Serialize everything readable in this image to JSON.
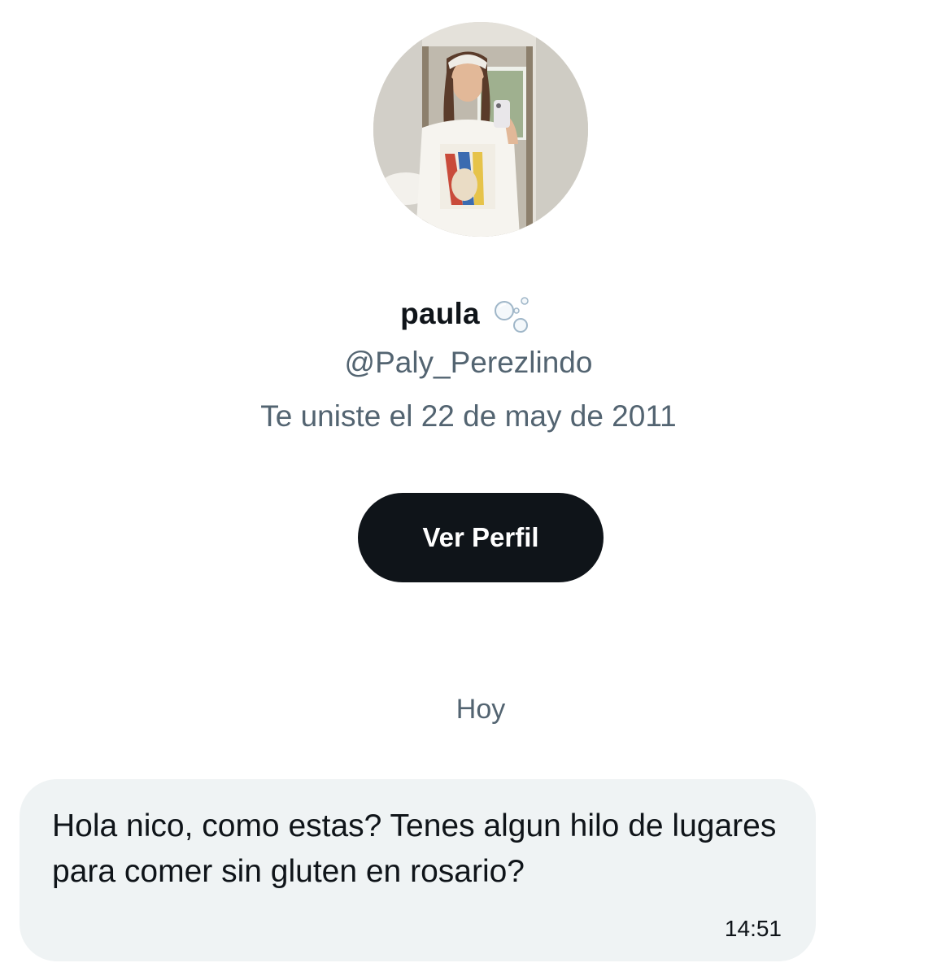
{
  "profile": {
    "display_name": "paula",
    "name_emoji_icon": "bubbles-icon",
    "handle": "@Paly_Perezlindo",
    "joined": "Te uniste el 22 de may de 2011",
    "view_profile_label": "Ver Perfil"
  },
  "conversation": {
    "day_label": "Hoy",
    "messages": [
      {
        "text": "Hola nico, como estas? Tenes algun hilo de lugares para comer sin gluten en rosario?",
        "time": "14:51"
      }
    ]
  },
  "colors": {
    "button_bg": "#0f1419",
    "secondary_text": "#536471",
    "bubble_bg": "#eff3f4"
  }
}
